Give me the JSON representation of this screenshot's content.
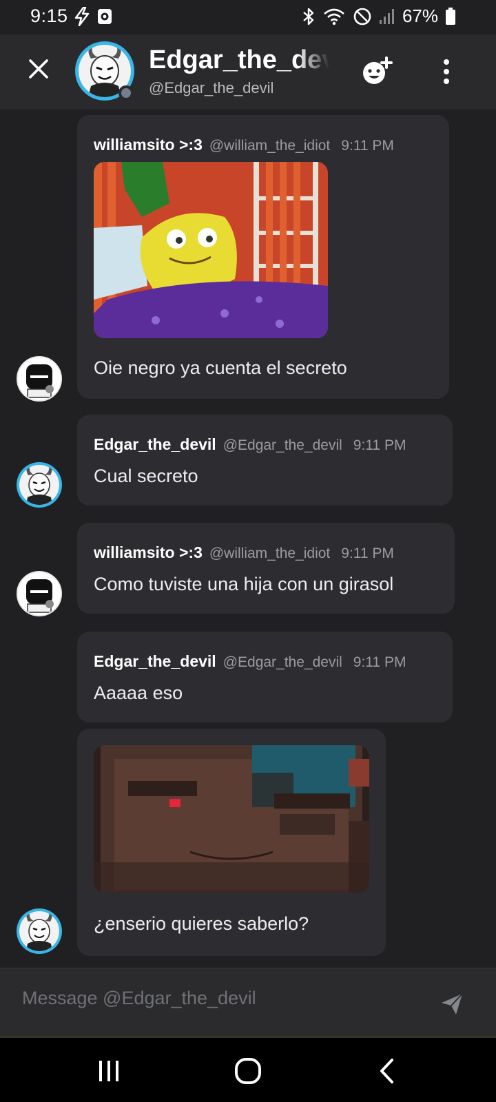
{
  "status_bar": {
    "time": "9:15",
    "battery": "67%"
  },
  "header": {
    "title": "Edgar_the_devil",
    "subtitle": "@Edgar_the_devil"
  },
  "messages": [
    {
      "author": "williamsito >:3",
      "handle": "@william_the_idiot",
      "time": "9:11 PM",
      "text": "Oie negro ya cuenta el secreto",
      "attachment": "spongebob-gif"
    },
    {
      "author": "Edgar_the_devil",
      "handle": "@Edgar_the_devil",
      "time": "9:11 PM",
      "text": "Cual secreto"
    },
    {
      "author": "williamsito >:3",
      "handle": "@william_the_idiot",
      "time": "9:11 PM",
      "text": "Como tuviste una hija con un girasol"
    },
    {
      "author": "Edgar_the_devil",
      "handle": "@Edgar_the_devil",
      "time": "9:11 PM",
      "text": "Aaaaa eso"
    },
    {
      "text": "¿enserio quieres saberlo?",
      "attachment": "minecraft-gif"
    }
  ],
  "composer": {
    "placeholder": "Message @Edgar_the_devil"
  },
  "colors": {
    "background": "#202023",
    "bubble": "#2d2d31",
    "header": "#2a2a2d",
    "avatar_ring": "#38b6e8",
    "offline_dot": "#747f8d"
  }
}
